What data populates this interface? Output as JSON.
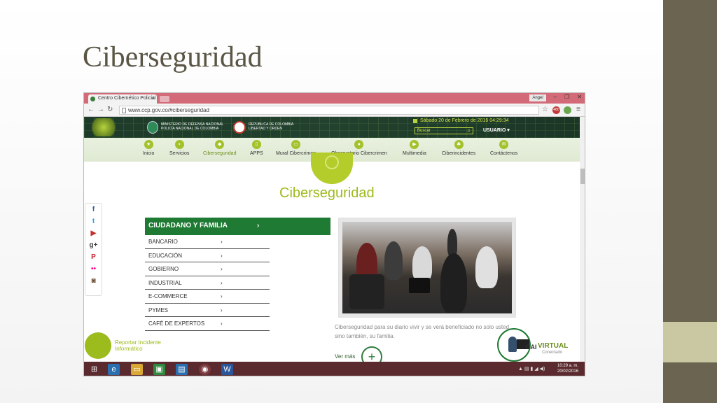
{
  "slide": {
    "title": "Ciberseguridad"
  },
  "browser": {
    "tab_title": "Centro Cibernético Policial",
    "user_name": "Angel",
    "url": "www.ccp.gov.co/#ciberseguridad",
    "badge_count": "480"
  },
  "site": {
    "ministry_text": "MINISTERIO DE DEFENSA NACIONAL\nPOLICÍA NACIONAL DE COLOMBIA",
    "republic_text": "REPÚBLICA DE COLOMBIA\nLIBERTAD Y ORDEN",
    "date": "Sábado 20 de Febrero de 2016 04:29:34",
    "search_placeholder": "Buscar",
    "user_menu": "USUARIO ▾"
  },
  "nav": [
    {
      "label": "Inicio"
    },
    {
      "label": "Servicios"
    },
    {
      "label": "Ciberseguridad"
    },
    {
      "label": "APPS"
    },
    {
      "label": "Mural Cibercrimen"
    },
    {
      "label": "Observatorio Cibercrimen"
    },
    {
      "label": "Multimedia"
    },
    {
      "label": "Ciberincidentes"
    },
    {
      "label": "Contáctenos"
    }
  ],
  "main": {
    "title": "Ciberseguridad",
    "menu_header": "CIUDADANO Y FAMILIA",
    "menu_items": [
      "BANCARIO",
      "EDUCACIÓN",
      "GOBIERNO",
      "INDUSTRIAL",
      "E-COMMERCE",
      "PYMES",
      "CAFÉ DE EXPERTOS"
    ],
    "description": "Ciberseguridad para su diario vivir y se verá beneficiado no solo usted, sino también, su familia.",
    "more_link": "Ver más",
    "report_label": "Reportar Incidente Informático",
    "cai_label": "CAI",
    "virtual_label": "VIRTUAL",
    "connected_label": "Conectado"
  },
  "taskbar": {
    "time": "10:29 a. m.",
    "date": "20/02/2016"
  },
  "colors": {
    "brand_green": "#9cbb1c",
    "menu_green": "#1f7a33",
    "title_brown": "#5a5545",
    "taskbar": "#5a2a2e",
    "side_dark": "#6b6450",
    "side_accent": "#c9c8a2"
  }
}
